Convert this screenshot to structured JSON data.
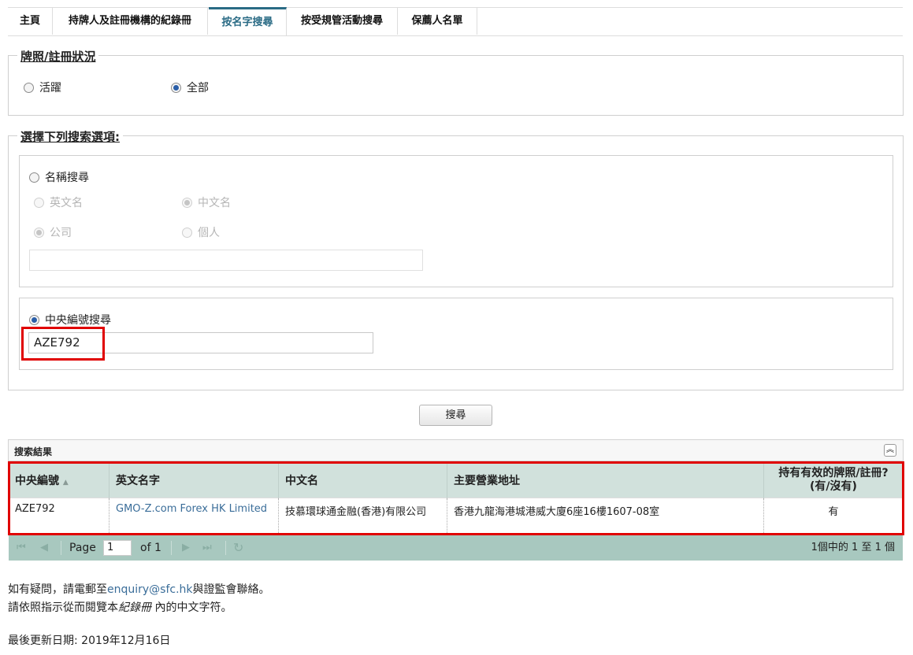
{
  "tabs": [
    "主頁",
    "持牌人及註冊機構的紀錄冊",
    "按名字搜尋",
    "按受規管活動搜尋",
    "保薦人名單"
  ],
  "license_status": {
    "legend": "牌照/註冊狀況",
    "opt_active": "活躍",
    "opt_all": "全部"
  },
  "search_options": {
    "legend": "選擇下列搜索選項:",
    "name_search": "名稱搜尋",
    "english_name": "英文名",
    "chinese_name": "中文名",
    "company": "公司",
    "individual": "個人",
    "central_search": "中央編號搜尋",
    "central_value": "AZE792"
  },
  "search_button": "搜尋",
  "results": {
    "title": "搜索結果",
    "columns": [
      "中央編號",
      "英文名字",
      "中文名",
      "主要營業地址",
      "持有有效的牌照/註冊?",
      "(有/沒有)"
    ],
    "rows": [
      {
        "ce": "AZE792",
        "en": "GMO-Z.com Forex HK Limited",
        "zh": "技慕環球通金融(香港)有限公司",
        "addr": "香港九龍海港城港威大廈6座16樓1607-08室",
        "valid": "有"
      }
    ]
  },
  "pager": {
    "page_label": "Page",
    "page_value": "1",
    "of_label": "of 1",
    "summary": "1個中的 1 至 1 個"
  },
  "footer": {
    "line1_pre": "如有疑問，請電郵至",
    "email": "enquiry@sfc.hk",
    "line1_post": "與證監會聯絡。",
    "line2_pre": "請依照指示從而閱覽本",
    "line2_em": "紀錄冊",
    "line2_post": " 內的中文字符。",
    "updated": "最後更新日期: 2019年12月16日"
  }
}
